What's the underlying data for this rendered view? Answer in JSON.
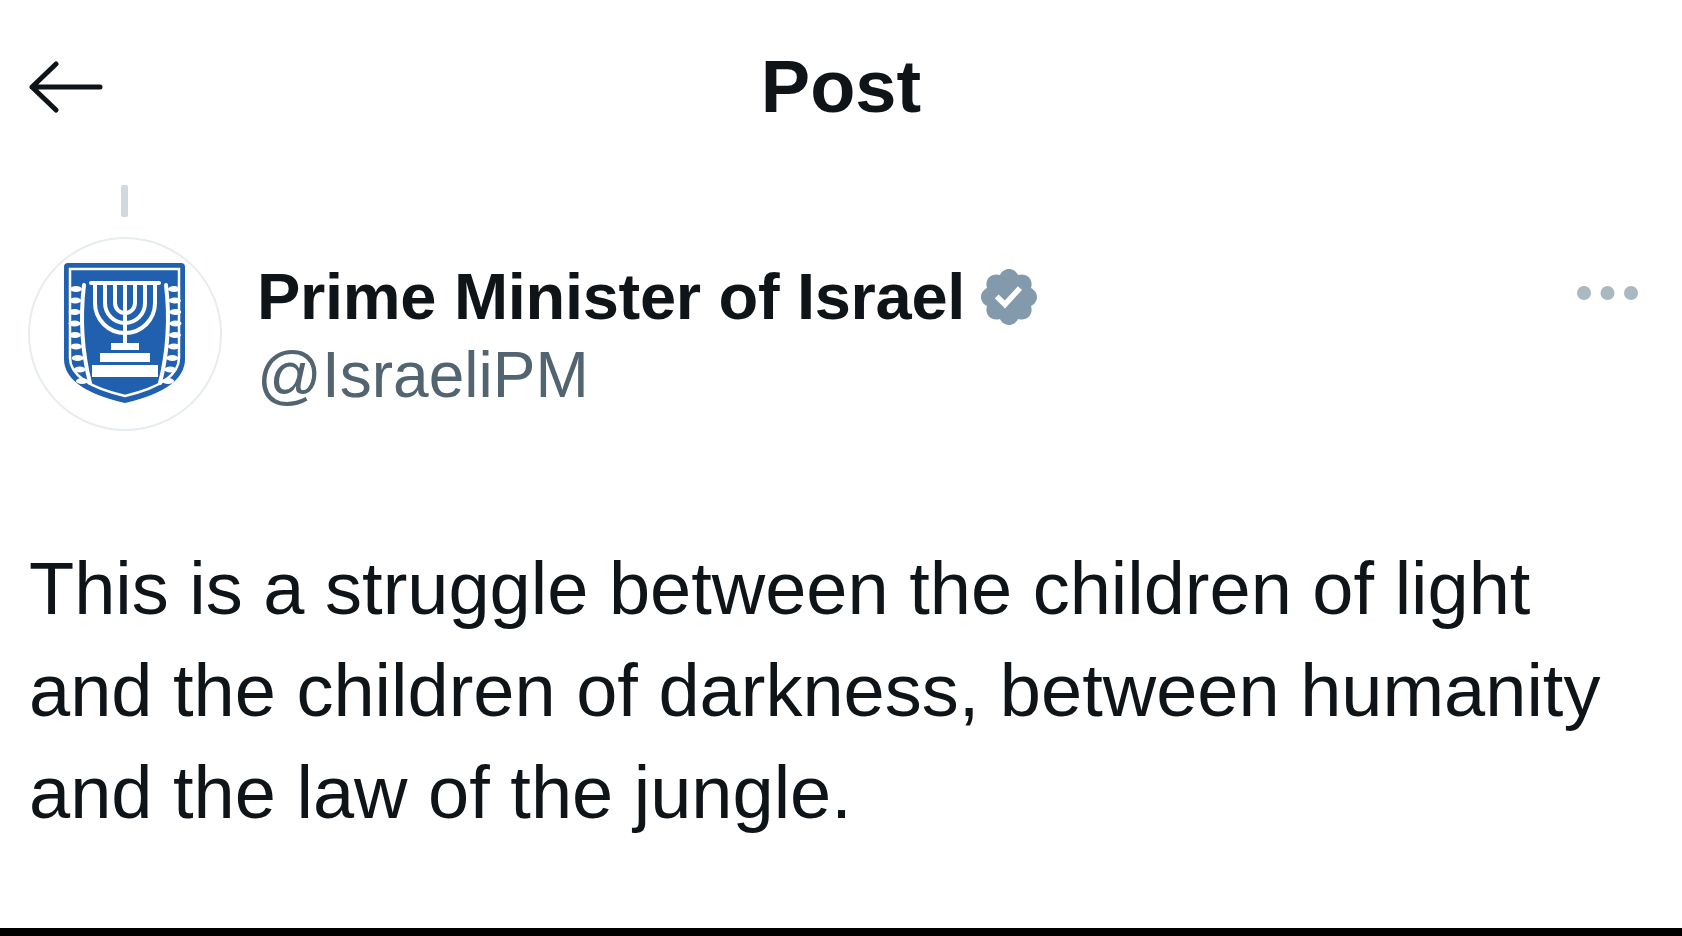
{
  "header": {
    "title": "Post"
  },
  "post": {
    "author": {
      "name": "Prime Minister of Israel",
      "verified": true,
      "handle": "@IsraeliPM"
    },
    "text": "This is a struggle between the children of light and the children of darkness, between humanity and the law of the jungle."
  }
}
